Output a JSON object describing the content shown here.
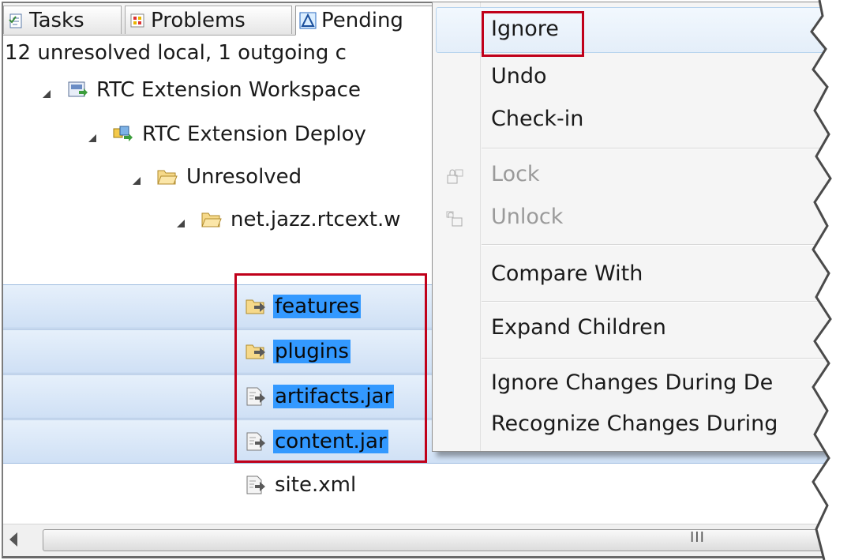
{
  "tabs": [
    {
      "label": "Tasks",
      "icon": "tasks-icon"
    },
    {
      "label": "Problems",
      "icon": "problems-icon"
    },
    {
      "label": "Pending",
      "icon": "pending-changes-icon"
    }
  ],
  "status_text": "12 unresolved local, 1 outgoing c",
  "tree": {
    "workspace": "RTC Extension Workspace",
    "component": "RTC Extension Deploy",
    "unresolved": "Unresolved",
    "folder": "net.jazz.rtcext.w",
    "items": [
      {
        "label": "features",
        "selected": true,
        "kind": "folder"
      },
      {
        "label": "plugins",
        "selected": true,
        "kind": "folder"
      },
      {
        "label": "artifacts.jar",
        "selected": true,
        "kind": "file"
      },
      {
        "label": "content.jar",
        "selected": true,
        "kind": "file"
      },
      {
        "label": "site.xml",
        "selected": false,
        "kind": "file"
      }
    ]
  },
  "menu": {
    "ignore": "Ignore",
    "undo": "Undo",
    "checkin": "Check-in",
    "lock": "Lock",
    "unlock": "Unlock",
    "compare": "Compare With",
    "expand": "Expand Children",
    "ignore_changes": "Ignore Changes During De",
    "recognize_changes": "Recognize Changes During"
  },
  "scrollbar": {
    "grip": "III"
  },
  "colors": {
    "selection": "#3399ff",
    "row_selected": "#cfe0f5",
    "annotation": "#c0001a",
    "menu_bg": "#f5f5f5"
  }
}
